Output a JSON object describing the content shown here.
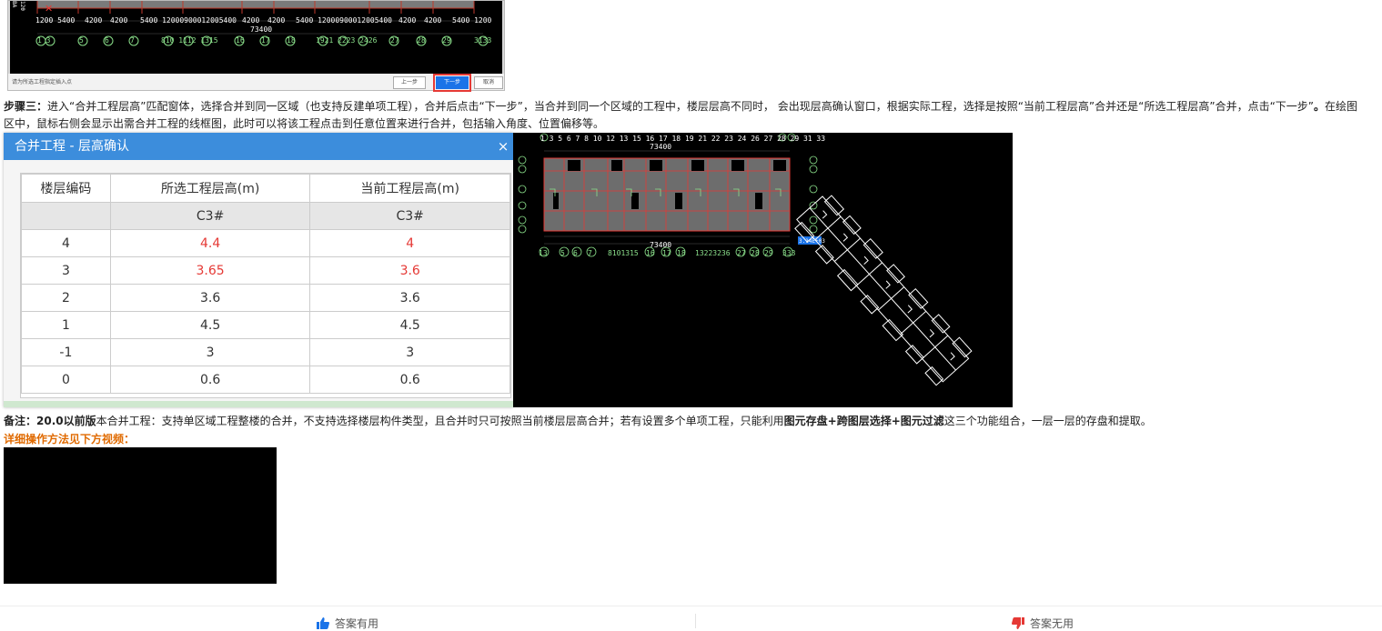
{
  "cad_top": {
    "dims": [
      "1200 5400",
      "4200",
      "4200",
      "5400 12000900012005400",
      "4200",
      "4200",
      "5400 12000900012005400",
      "4200",
      "4200",
      "5400 1200"
    ],
    "total": "73400",
    "axes": [
      "1 3",
      "5",
      "6",
      "7",
      "810 1112 1315",
      "16",
      "17",
      "18",
      "1921 2223 2426",
      "27",
      "28",
      "29",
      "3133"
    ],
    "hint": "请为所选工程指定插入点",
    "btn_prev": "上一步",
    "btn_next": "下一步",
    "btn_cancel": "取消"
  },
  "step3": {
    "label": "步骤三：",
    "part1": "进入“合并工程层高”匹配窗体，选择合并到同一区域（也支持反建单项工程），合并后点击“下一步”，当合并到同一个区域的工程中，楼层层高不同时， 会出现层高确认窗口，根据实际工程，选择是按照“当前工程层高”合并还是“所选工程层高”合并，点击“下一步”",
    "part2": "。",
    "part3": "在绘图区中，鼠标右侧会显示出需合并工程的线框图，此时可以将该工程点击到任意位置来进行合并，包括输入角度、位置偏移等。"
  },
  "dialog": {
    "title": "合并工程 - 层高确认",
    "close": "×",
    "headers": [
      "楼层编码",
      "所选工程层高(m)",
      "当前工程层高(m)"
    ],
    "sub": [
      "",
      "C3#",
      "C3#"
    ],
    "rows": [
      {
        "code": "4",
        "sel": "4.4",
        "cur": "4",
        "diff": true
      },
      {
        "code": "3",
        "sel": "3.65",
        "cur": "3.6",
        "diff": true
      },
      {
        "code": "2",
        "sel": "3.6",
        "cur": "3.6",
        "diff": false
      },
      {
        "code": "1",
        "sel": "4.5",
        "cur": "4.5",
        "diff": false
      },
      {
        "code": "-1",
        "sel": "3",
        "cur": "3",
        "diff": false
      },
      {
        "code": "0",
        "sel": "0.6",
        "cur": "0.6",
        "diff": false
      }
    ]
  },
  "cad_right": {
    "top_axes": "1 3 5 6 7 8 10 12 13 15 16 17 18 19 21 22 23 24 26 27 28 29 31 33",
    "total": "73400",
    "bottom_axes": [
      "13",
      "5",
      "6",
      "7",
      "8101315",
      "16",
      "17",
      "18",
      "13223236",
      "27",
      "28",
      "29",
      "333"
    ],
    "cursor_value": "3.14E+03"
  },
  "note": {
    "label": "备注：",
    "version": "20.0以前版",
    "part1": "本合并工程：支持单区域工程整楼的合并，不支持选择楼层构件类型，且合并时只可按照当前楼层层高合并；若有设置多个单项工程，只能利用",
    "feature": "图元存盘+跨图层选择+图元过滤",
    "part2": "这三个功能组合，一层一层的存盘和提取。"
  },
  "video_link": "详细操作方法见下方视频：",
  "feedback": {
    "useful": "答案有用",
    "useless": "答案无用",
    "useful_color": "#1a73e8",
    "useless_color": "#e53935"
  }
}
